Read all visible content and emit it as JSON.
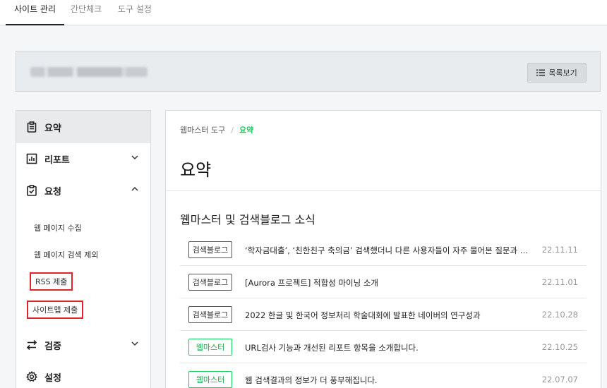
{
  "top_tabs": [
    "사이트 관리",
    "간단체크",
    "도구 설정"
  ],
  "header": {
    "list_button_label": "목록보기"
  },
  "sidebar": {
    "summary": "요약",
    "report": "리포트",
    "request": "요청",
    "request_items": [
      "웹 페이지 수집",
      "웹 페이지 검색 제외",
      "RSS 제출",
      "사이트맵 제출"
    ],
    "verify": "검증",
    "settings": "설정"
  },
  "main": {
    "breadcrumb": {
      "root": "웹마스터 도구",
      "separator": "/",
      "current": "요약"
    },
    "title": "요약",
    "section_title": "웹마스터 및 검색블로그 소식",
    "news": [
      {
        "badge": "검색블로그",
        "title": "‘학자금대출’, ‘친한친구 축의금’ 검색했더니 다른 사용자들이 자주 물어본 질문과 답변이",
        "date": "22.11.11"
      },
      {
        "badge": "검색블로그",
        "title": "[Aurora 프로젝트] 적합성 마이닝 소개",
        "date": "22.11.01"
      },
      {
        "badge": "검색블로그",
        "title": "2022 한글 및 한국어 정보처리 학술대회에 발표한 네이버의 연구성과",
        "date": "22.10.28"
      },
      {
        "badge": "웹마스터",
        "title": "URL검사 기능과 개선된 리포트 항목을 소개합니다.",
        "date": "22.10.25"
      },
      {
        "badge": "웹마스터",
        "title": "웹 검색결과의 정보가 더 풍부해집니다.",
        "date": "22.07.07"
      }
    ]
  },
  "colors": {
    "accent_green": "#19ce60",
    "highlight_red": "#e0242c"
  }
}
